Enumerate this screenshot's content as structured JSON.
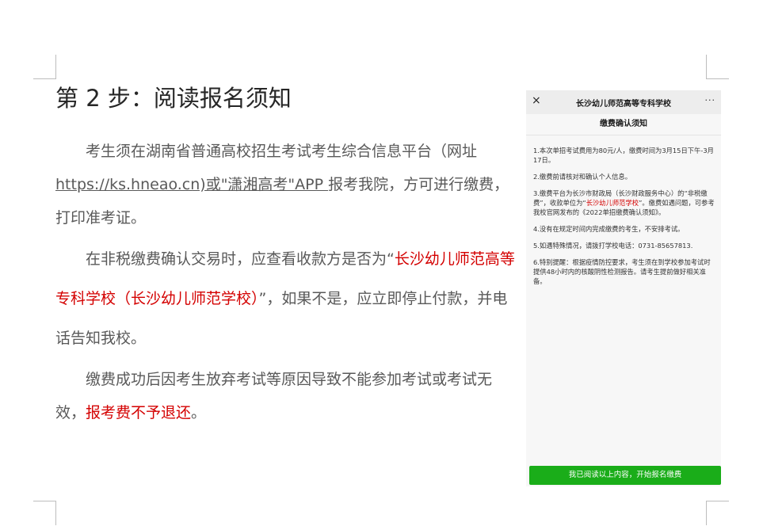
{
  "doc": {
    "title": "第 2 步：阅读报名须知",
    "p1_a": "考生须在湖南省普通高校招生考试考生综合信息平台（网址",
    "p1_link": "https://ks.hneao.cn)或\"潇湘高考\"APP ",
    "p1_b": "报考我院，方可进行缴费，打印准考证。",
    "p2_a": "在非税缴费确认交易时，应查看收款方是否为“",
    "p2_red": "长沙幼儿师范高等专科学校（长沙幼儿师范学校）",
    "p2_b": "”，如果不是，应立即停止付款，并电话告知我校。",
    "p3_a": "缴费成功后因考生放弃考试等原因导致不能参加考试或考试无效，",
    "p3_red": "报考费不予退还",
    "p3_b": "。"
  },
  "phone": {
    "close": "×",
    "title": "长沙幼儿师范高等专科学校",
    "more": "···",
    "subtitle": "缴费确认须知",
    "items": [
      "1.本次单招考试费用为80元/人，缴费时间为3月15日下午-3月17日。",
      "2.缴费前请核对和确认个人信息。",
      "4.没有在规定时间内完成缴费的考生，不安排考试。",
      "5.如遇特殊情况，请拨打学校电话：0731-85657813.",
      "6.特别提醒：根据疫情防控要求，考生须在到学校参加考试时提供48小时内的核酸阴性检测报告。请考生提前做好相关准备。"
    ],
    "item3_a": "3.缴费平台为长沙市财政局（长沙财政服务中心）的“非税缴费”，收款单位为“",
    "item3_red": "长沙幼儿师范学校",
    "item3_b": "”。缴费如遇问题，可参考我校官网发布的《2022单招缴费确认须知》。",
    "button": "我已阅读以上内容，开始报名缴费"
  },
  "colors": {
    "accent_red": "#d40000",
    "button_green": "#1aad19"
  }
}
